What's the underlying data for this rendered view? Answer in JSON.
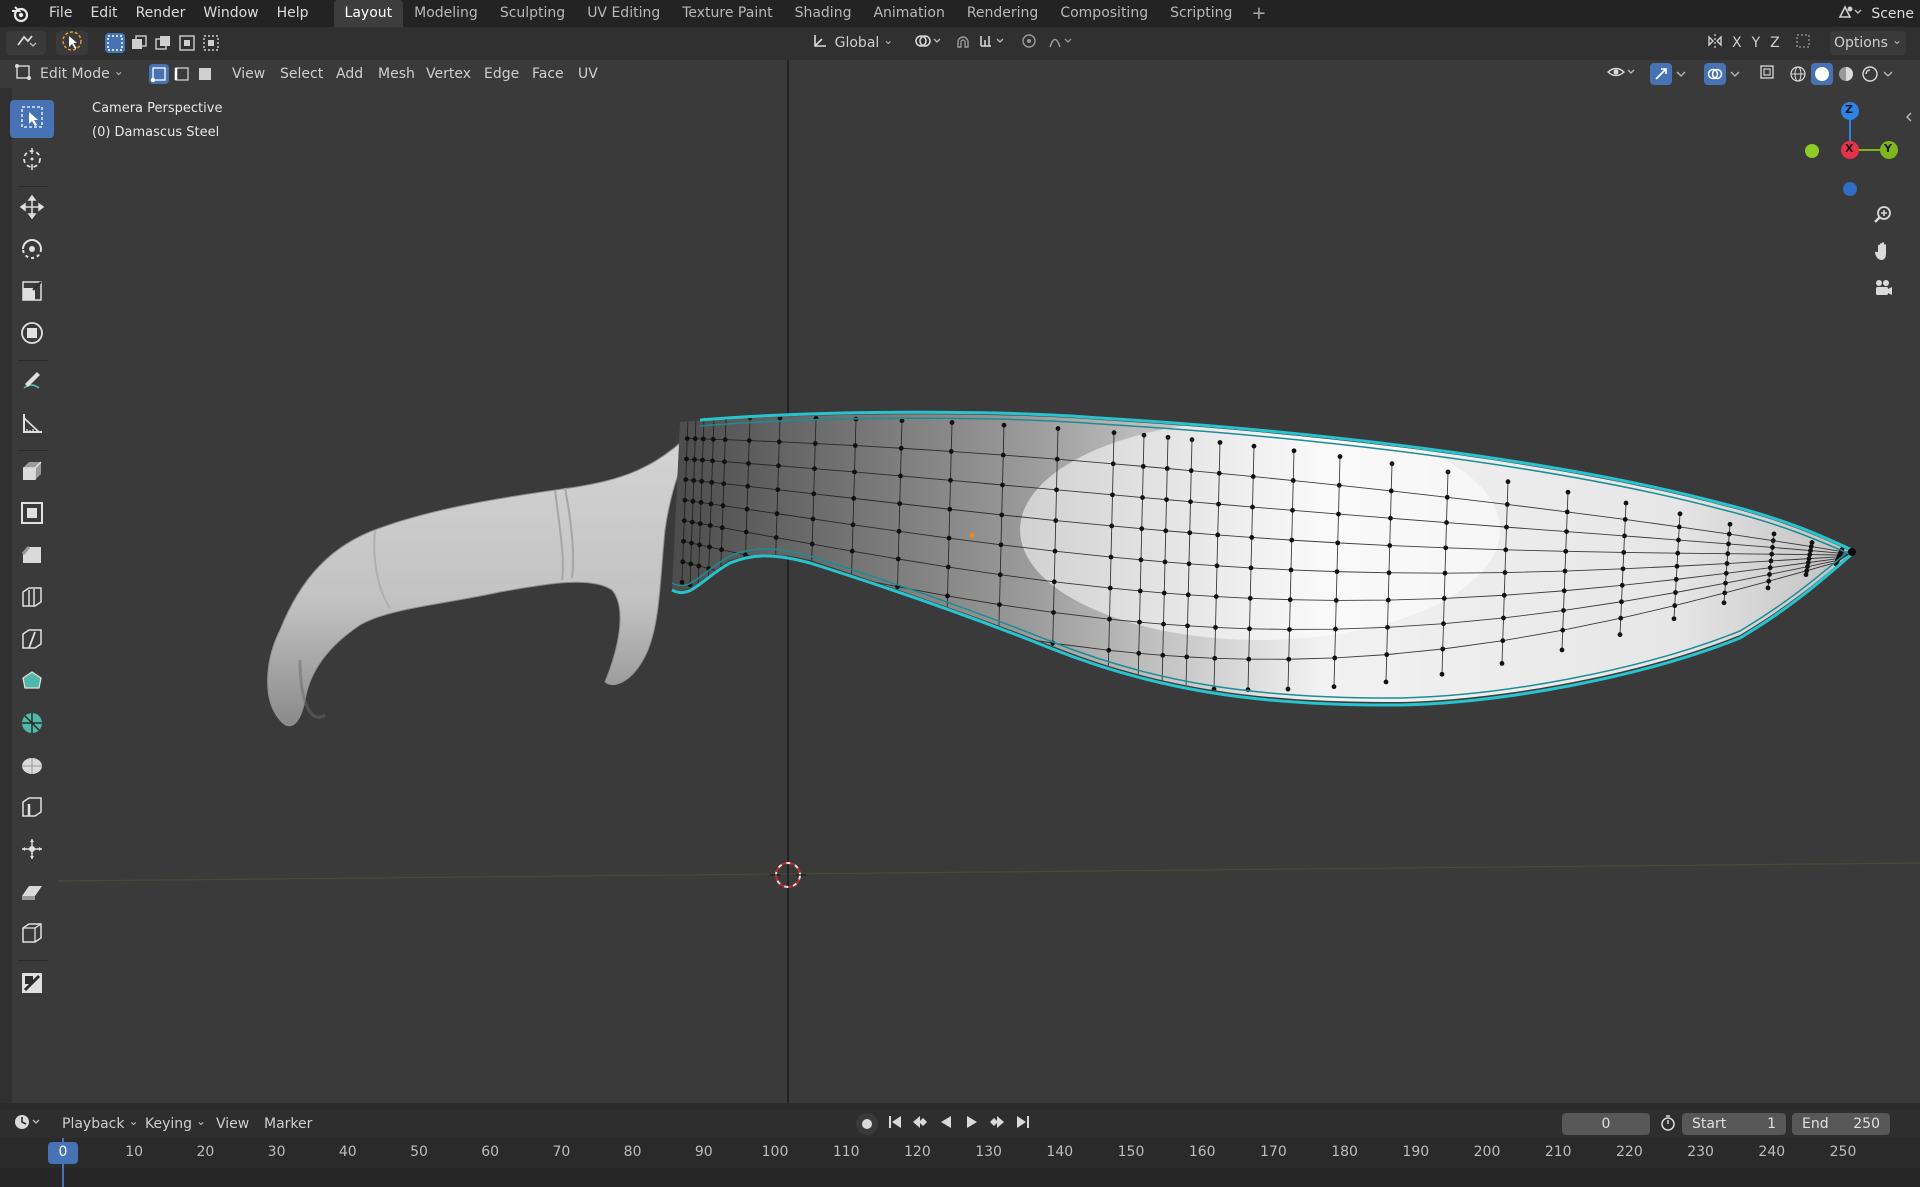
{
  "topbar": {
    "menus": [
      "File",
      "Edit",
      "Render",
      "Window",
      "Help"
    ],
    "workspaces": [
      "Layout",
      "Modeling",
      "Sculpting",
      "UV Editing",
      "Texture Paint",
      "Shading",
      "Animation",
      "Rendering",
      "Compositing",
      "Scripting"
    ],
    "active_workspace": "Layout",
    "add_tab": "+",
    "scene_label": "Scene"
  },
  "toolheader": {
    "orientation": "Global",
    "axes": [
      "X",
      "Y",
      "Z"
    ],
    "options_label": "Options"
  },
  "modeheader": {
    "mode": "Edit Mode",
    "menus": [
      "View",
      "Select",
      "Add",
      "Mesh",
      "Vertex",
      "Edge",
      "Face",
      "UV"
    ]
  },
  "viewport": {
    "perspective_label": "Camera Perspective",
    "object_label": "(0) Damascus Steel"
  },
  "gizmo": {
    "z_label": "Z",
    "x_label": "X",
    "y_label": "Y",
    "colors": {
      "x": "#e8314a",
      "y": "#7fb51d",
      "z": "#2f83e6"
    }
  },
  "timeline": {
    "menus": [
      "Playback",
      "Keying",
      "View",
      "Marker"
    ],
    "current_frame": "0",
    "start_label": "Start",
    "start_value": "1",
    "end_label": "End",
    "end_value": "250",
    "ruler": [
      "0",
      "10",
      "20",
      "30",
      "40",
      "50",
      "60",
      "70",
      "80",
      "90",
      "100",
      "110",
      "120",
      "130",
      "140",
      "150",
      "160",
      "170",
      "180",
      "190",
      "200",
      "210",
      "220",
      "230",
      "240",
      "250"
    ]
  },
  "colors": {
    "accent": "#4772b3",
    "selection_edge": "#27c4cf",
    "background": "#3a3a3a"
  }
}
